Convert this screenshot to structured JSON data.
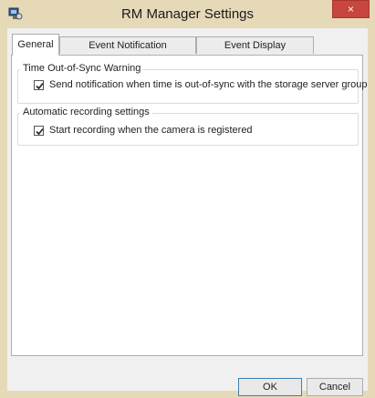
{
  "window": {
    "title": "RM Manager Settings",
    "close_symbol": "×",
    "app_icon": "rm-manager-app-icon"
  },
  "tabs": [
    {
      "label": "General",
      "selected": true
    },
    {
      "label": "Event Notification",
      "selected": false
    },
    {
      "label": "Event Display",
      "selected": false
    }
  ],
  "general": {
    "time_sync_group": {
      "legend": "Time Out-of-Sync Warning",
      "checkbox_label": "Send notification when time is out-of-sync with the storage server group",
      "checked": true
    },
    "recording_group": {
      "legend": "Automatic recording settings",
      "checkbox_label": "Start recording when the camera is registered",
      "checked": true
    }
  },
  "buttons": {
    "ok": "OK",
    "cancel": "Cancel"
  }
}
